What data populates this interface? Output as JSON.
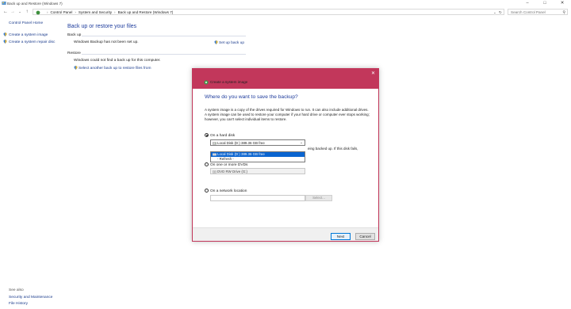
{
  "window": {
    "title": "Back up and Restore (Windows 7)",
    "minimize": "–",
    "maximize": "□",
    "close": "✕"
  },
  "addressbar": {
    "crumbs": [
      "Control Panel",
      "System and Security",
      "Back up and Restore (Windows 7)"
    ],
    "search_placeholder": "Search Control Panel"
  },
  "leftnav": {
    "home": "Control Panel Home",
    "tasks": [
      "Create a system image",
      "Create a system repair disc"
    ],
    "see_also_label": "See also",
    "see_also": [
      "Security and Maintenance",
      "File History"
    ]
  },
  "main": {
    "title": "Back up or restore your files",
    "backup_section": "Back up",
    "backup_status": "Windows Backup has not been set up.",
    "setup_link": "Set up back up",
    "restore_section": "Restore",
    "restore_status": "Windows could not find a back up for this computer.",
    "restore_link": "Select another back up to restore files from"
  },
  "dialog": {
    "caption": "Create a system image",
    "close": "✕",
    "heading": "Where do you want to save the backup?",
    "description": "A system image is a copy of the drives required for Windows to run. It can also include additional drives. A system image can be used to restore your computer if your hard drive or computer ever stops working; however, you can't select individual items to restore.",
    "options": {
      "hard_disk": {
        "label": "On a hard disk",
        "selected": "Local Disk (D:)  389.36 GB free",
        "list": [
          "Local Disk (D:)  389.36 GB free",
          "- Refresh -"
        ],
        "hint_fragment": "eing backed up. If this disk fails,"
      },
      "dvds": {
        "label": "On one or more DVDs",
        "selected": "DVD RW Drive (G:)"
      },
      "network": {
        "label": "On a network location",
        "value": "",
        "browse": "Select..."
      }
    },
    "buttons": {
      "next": "Next",
      "cancel": "Cancel"
    }
  },
  "colors": {
    "accent_title": "#c2375b",
    "link": "#1a3b8c",
    "heading": "#1e3c9c",
    "selection": "#0a64d0"
  }
}
